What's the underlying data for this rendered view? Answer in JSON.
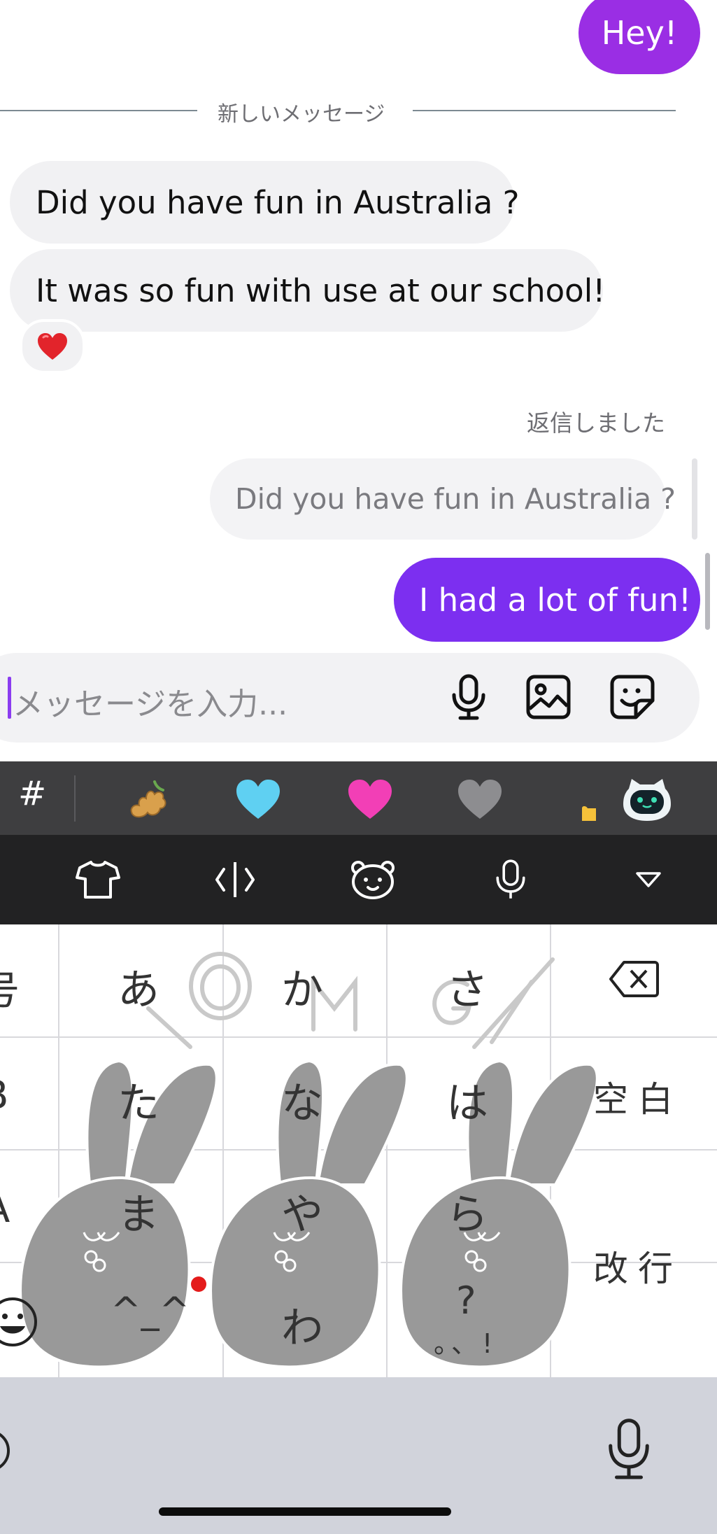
{
  "chat": {
    "sent_hey": "Hey!",
    "divider": "新しいメッセージ",
    "recv_1": "Did you have fun in Australia ?",
    "recv_2": "It was so fun with use at our school!",
    "reaction": "heart",
    "replied_label": "返信しました",
    "reply_quote": "Did you have fun in Australia ?",
    "sent_reply": "I had a lot of fun!"
  },
  "composer": {
    "placeholder": "メッセージを入力...",
    "icons": [
      "microphone-icon",
      "image-icon",
      "sticker-icon"
    ]
  },
  "emoji_bar": {
    "hash": "#",
    "items": [
      "ginger",
      "light-blue-heart",
      "pink-heart",
      "grey-heart",
      "raised-hand",
      "cat-face-sticker"
    ]
  },
  "keyboard_toolbar": {
    "icons": [
      "shirt-icon",
      "cursor-icon",
      "bear-face-icon",
      "microphone-icon",
      "collapse-triangle-icon"
    ]
  },
  "keyboard": {
    "left_col": [
      "号",
      "B",
      "A"
    ],
    "rows": [
      [
        "あ",
        "か",
        "さ"
      ],
      [
        "た",
        "な",
        "は"
      ],
      [
        "ま",
        "や",
        "ら"
      ],
      [
        "^_^",
        "わ",
        "?"
      ]
    ],
    "punct": "。、!",
    "space": "空白",
    "enter": "改行",
    "theme_text": "OMG"
  },
  "colors": {
    "sent_bubble": "#9a2ee4",
    "sent_bubble_2": "#7c2ff0",
    "received_bubble": "#f1f1f3",
    "keyboard_bar": "#3e3e40",
    "toolbar": "#222223"
  }
}
